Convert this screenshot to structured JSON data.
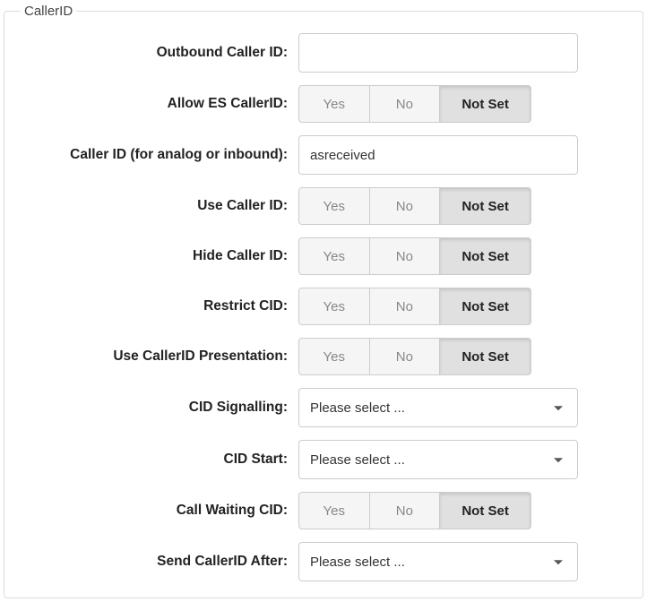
{
  "legend": "CallerID",
  "options": {
    "yes": "Yes",
    "no": "No",
    "notset": "Not Set"
  },
  "rows": {
    "outbound_cid": {
      "label": "Outbound Caller ID:",
      "value": ""
    },
    "allow_es": {
      "label": "Allow ES CallerID:",
      "selected": "notset"
    },
    "cid_analog": {
      "label": "Caller ID (for analog or inbound):",
      "value": "asreceived"
    },
    "use_cid": {
      "label": "Use Caller ID:",
      "selected": "notset"
    },
    "hide_cid": {
      "label": "Hide Caller ID:",
      "selected": "notset"
    },
    "restrict_cid": {
      "label": "Restrict CID:",
      "selected": "notset"
    },
    "use_cid_pres": {
      "label": "Use CallerID Presentation:",
      "selected": "notset"
    },
    "cid_signalling": {
      "label": "CID Signalling:",
      "placeholder": "Please select ..."
    },
    "cid_start": {
      "label": "CID Start:",
      "placeholder": "Please select ..."
    },
    "callwaiting_cid": {
      "label": "Call Waiting CID:",
      "selected": "notset"
    },
    "send_cid_after": {
      "label": "Send CallerID After:",
      "placeholder": "Please select ..."
    }
  }
}
